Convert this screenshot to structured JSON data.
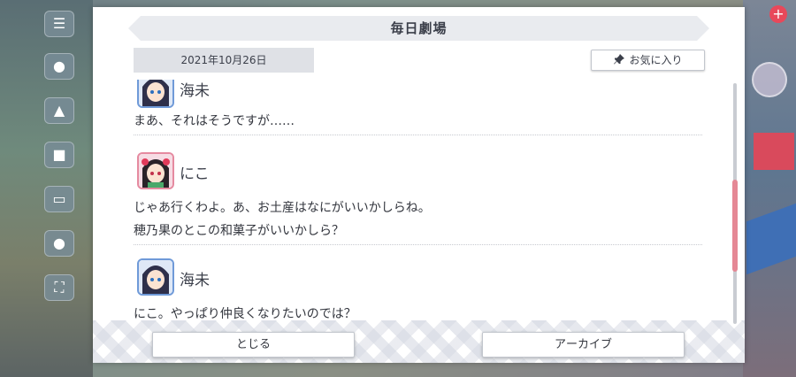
{
  "dialog": {
    "title": "毎日劇場",
    "date": "2021年10月26日",
    "favorite_label": "お気に入り"
  },
  "entries": [
    {
      "speaker": "海未",
      "avatar_color": "#6f9ad8",
      "lines": [
        "まあ、それはそうですが……"
      ]
    },
    {
      "speaker": "にこ",
      "avatar_color": "#e58aa0",
      "lines": [
        "じゃあ行くわよ。あ、お土産はなにがいいかしらね。",
        "穂乃果のとこの和菓子がいいかしら？"
      ]
    },
    {
      "speaker": "海未",
      "avatar_color": "#6f9ad8",
      "lines": [
        "にこ。やっぱり仲良くなりたいのでは？"
      ]
    }
  ],
  "buttons": {
    "close_label": "とじる",
    "archive_label": "アーカイブ"
  },
  "colors": {
    "scroll_thumb": "#e58895",
    "title_bar": "#e9ebef"
  }
}
